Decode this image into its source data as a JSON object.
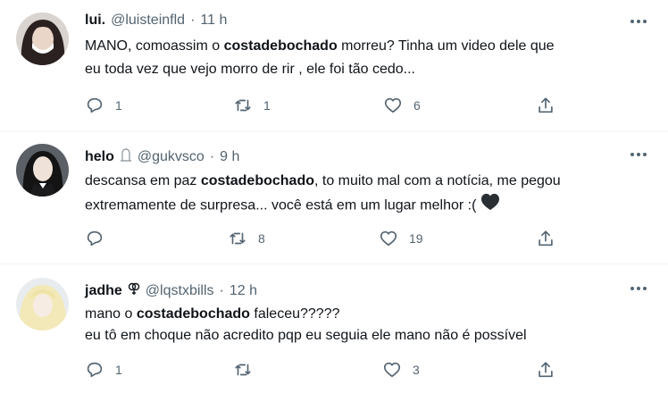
{
  "tweets": [
    {
      "name": "lui.",
      "handle": "@luisteinfld",
      "time": "11 h",
      "lines": [
        {
          "pre": "MANO, comoassim o ",
          "bold": "costadebochado",
          "post": " morreu? Tinha um video dele que"
        },
        {
          "pre": "eu toda vez que vejo morro de rir , ele foi tão cedo...",
          "bold": "",
          "post": ""
        }
      ],
      "reply_count": "1",
      "retweet_count": "1",
      "like_count": "6"
    },
    {
      "name": "helo",
      "handle": "@gukvsco",
      "time": "9 h",
      "lines": [
        {
          "pre": "descansa em paz ",
          "bold": "costadebochado",
          "post": ", to muito mal com a notícia, me pegou"
        },
        {
          "pre": "extremamente de surpresa... você está em um lugar melhor :(",
          "bold": "",
          "post": ""
        }
      ],
      "reply_count": "",
      "retweet_count": "8",
      "like_count": "19"
    },
    {
      "name": "jadhe",
      "handle": "@lqstxbills",
      "time": "12 h",
      "lines": [
        {
          "pre": "mano o ",
          "bold": "costadebochado",
          "post": " faleceu?????"
        },
        {
          "pre": "eu tô em choque não acredito pqp eu seguia ele mano não é possível",
          "bold": "",
          "post": ""
        }
      ],
      "reply_count": "1",
      "retweet_count": "",
      "like_count": "3"
    }
  ],
  "separator": "·",
  "icons": {
    "reply": "reply-icon",
    "retweet": "retweet-icon",
    "like": "heart-icon",
    "share": "share-icon",
    "more": "more-options-icon",
    "helo_badge": "grave-symbol-icon",
    "jadhe_badge": "gender-symbol-icon",
    "black_heart": "black-heart-emoji"
  },
  "colors": {
    "text": "#0f1419",
    "secondary": "#536471",
    "divider": "#eff3f4"
  }
}
